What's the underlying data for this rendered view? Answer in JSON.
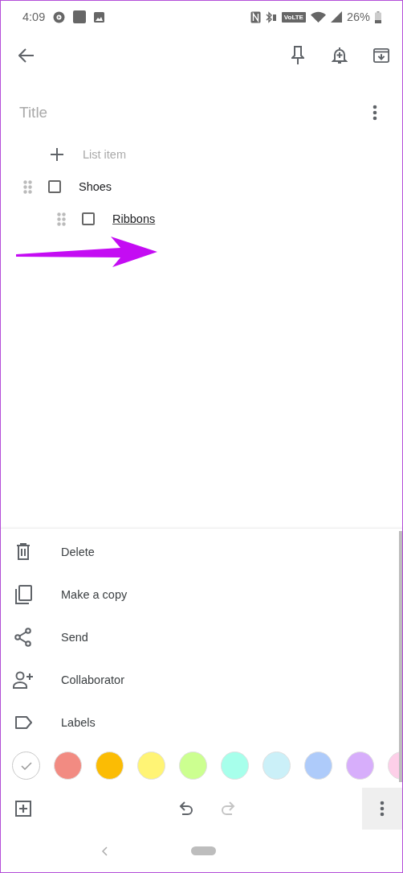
{
  "status_bar": {
    "time": "4:09",
    "network_badge": "VoLTE",
    "battery": "26%"
  },
  "note": {
    "title_placeholder": "Title",
    "add_item_placeholder": "List item",
    "items": [
      {
        "text": "Shoes",
        "checked": false,
        "misspelled": false,
        "children": [
          {
            "text": "Ribbons",
            "checked": false,
            "misspelled": true
          }
        ]
      }
    ]
  },
  "menu": [
    {
      "kind": "delete",
      "label": "Delete"
    },
    {
      "kind": "copy",
      "label": "Make a copy"
    },
    {
      "kind": "send",
      "label": "Send"
    },
    {
      "kind": "collaborator",
      "label": "Collaborator"
    },
    {
      "kind": "labels",
      "label": "Labels"
    }
  ],
  "colors": [
    {
      "color": "#ffffff",
      "selected": true
    },
    {
      "color": "#f28b82",
      "selected": false
    },
    {
      "color": "#fbbc04",
      "selected": false
    },
    {
      "color": "#fff475",
      "selected": false
    },
    {
      "color": "#ccff90",
      "selected": false
    },
    {
      "color": "#a7ffeb",
      "selected": false
    },
    {
      "color": "#cbf0f8",
      "selected": false
    },
    {
      "color": "#aecbfa",
      "selected": false
    },
    {
      "color": "#d7aefb",
      "selected": false
    },
    {
      "color": "#fdcfe8",
      "selected": false
    }
  ],
  "bottom_bar": [
    {
      "kind": "add",
      "disabled": false,
      "pressed": false
    },
    {
      "kind": "undo",
      "disabled": false,
      "pressed": false
    },
    {
      "kind": "redo",
      "disabled": true,
      "pressed": false
    },
    {
      "kind": "more",
      "disabled": false,
      "pressed": true
    }
  ]
}
